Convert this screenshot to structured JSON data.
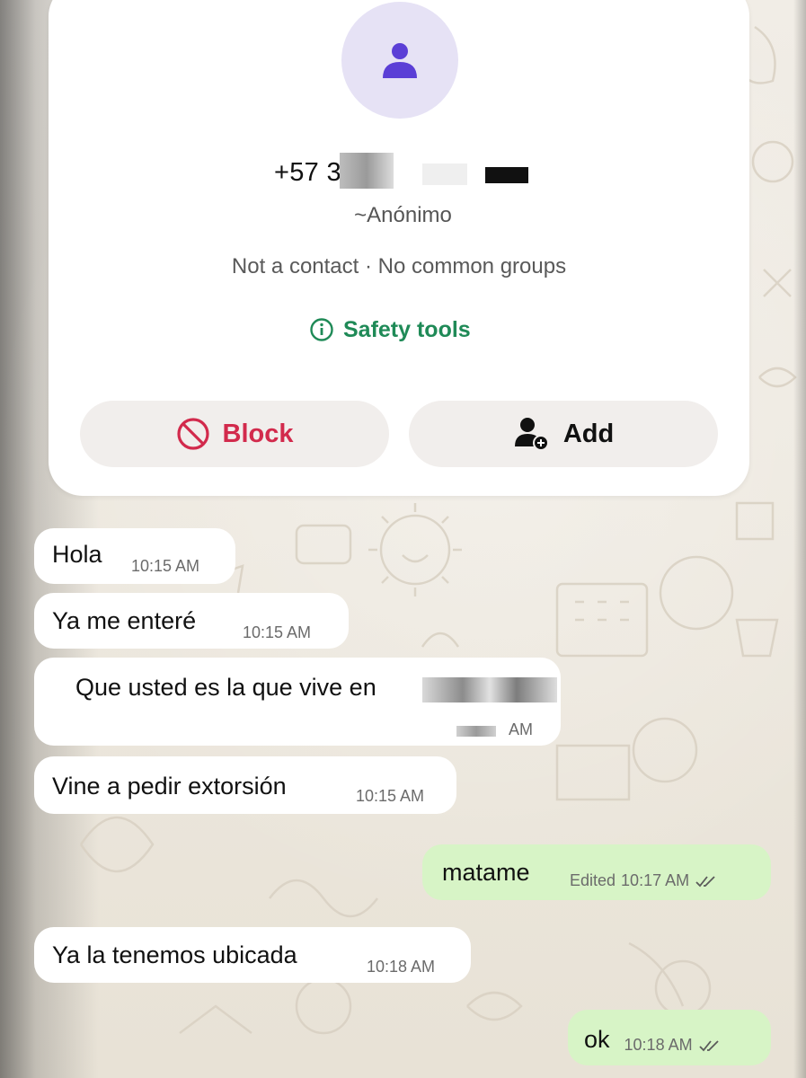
{
  "profile": {
    "avatar_icon": "person-icon",
    "phone_number": "+57 3",
    "alias": "~Anónimo",
    "status": "Not a contact · No common groups",
    "safety_tools_label": "Safety tools",
    "block_label": "Block",
    "add_label": "Add"
  },
  "messages": [
    {
      "direction": "in",
      "text": "Hola",
      "time": "10:15 AM"
    },
    {
      "direction": "in",
      "text": "Ya me enteré",
      "time": "10:15 AM"
    },
    {
      "direction": "in",
      "text": "Que usted es la que vive en",
      "time": "AM"
    },
    {
      "direction": "in",
      "text": "Vine a pedir extorsión",
      "time": "10:15 AM"
    },
    {
      "direction": "out",
      "text": "matame",
      "edited_label": "Edited",
      "time": "10:17 AM",
      "status_icon": "double-check-icon"
    },
    {
      "direction": "in",
      "text": "Ya la tenemos ubicada",
      "time": "10:18 AM"
    },
    {
      "direction": "out",
      "text": "ok",
      "time": "10:18 AM",
      "status_icon": "double-check-icon"
    }
  ],
  "colors": {
    "accent_green": "#1f8a57",
    "block_red": "#d22a4c",
    "outgoing_bubble": "#d7f4c6",
    "incoming_bubble": "#ffffff",
    "avatar_bg": "#e6e2f5",
    "avatar_fg": "#5b3fd6"
  }
}
